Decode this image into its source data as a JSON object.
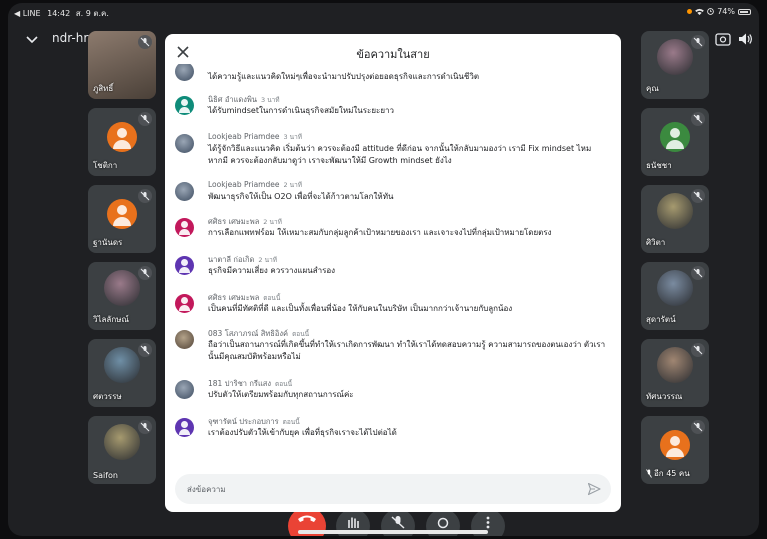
{
  "status_bar": {
    "back_app": "◀ LINE",
    "time": "14:42",
    "date": "ส. 9 ต.ค.",
    "battery": "74%"
  },
  "meeting": {
    "code": "ndr-hryf-rac",
    "code_arrow": "▸"
  },
  "participants_left": [
    {
      "name": "ภูสิทธิ์",
      "kind": "video"
    },
    {
      "name": "โชติกา",
      "kind": "initial",
      "color": "#e8711c"
    },
    {
      "name": "ฐานันดร",
      "kind": "initial",
      "color": "#e8711c"
    },
    {
      "name": "วิไลลักษณ์",
      "kind": "photo"
    },
    {
      "name": "ศตวรรษ",
      "kind": "photo"
    },
    {
      "name": "Saifon",
      "kind": "photo"
    }
  ],
  "participants_right": [
    {
      "name": "คุณ",
      "kind": "photo"
    },
    {
      "name": "ธนัชชา",
      "kind": "initial",
      "color": "#3b8a3f"
    },
    {
      "name": "ศิวิตา",
      "kind": "photo"
    },
    {
      "name": "สุดารัตน์",
      "kind": "photo"
    },
    {
      "name": "ทัศนวรรณ",
      "kind": "photo"
    },
    {
      "name": "อีก 45 คน",
      "kind": "initial",
      "color": "#e8711c"
    }
  ],
  "dialog": {
    "title": "ข้อความในสาย",
    "messages": [
      {
        "name": "",
        "time": "",
        "text": "ได้ความรู้และแนวคิดใหม่ๆเพื่อจะนำมาปรับปรุงต่อยอดธุรกิจและการดำเนินชีวิต",
        "avatar": "av-photo"
      },
      {
        "name": "นิธิศ อำแดงพิน",
        "time": "3 นาที",
        "text": "ได้รับmindsetในการดำเนินธุรกิจสมัยใหม่ในระยะยาว",
        "avatar": "av-teal"
      },
      {
        "name": "Lookjeab Priamdee",
        "time": "3 นาที",
        "text": "ได้รู้จักวิธีและแนวคิด เริ่มต้นว่า ควรจะต้องมี attitude ที่ดีก่อน จากนั้นให้กลับมามองว่า เรามี Fix mindset ไหม หากมี ควรจะต้องกลับมาดูว่า เราจะพัฒนาให้มี Growth mindset ยังไง",
        "avatar": "av-photo"
      },
      {
        "name": "Lookjeab Priamdee",
        "time": "2 นาที",
        "text": "พัฒนาธุรกิจให้เป็น O2O เพื่อที่จะได้ก้าวตามโลกให้ทัน",
        "avatar": "av-photo"
      },
      {
        "name": "ศศิธร เศษมะพล",
        "time": "2 นาที",
        "text": "การเลือกแพทฟร์อม ให้เหมาะสมกับกลุ่มลูกค้าเป้าหมายของเรา และเจาะจงไปที่กลุ่มเป้าหมายโดยตรง",
        "avatar": "av-pink"
      },
      {
        "name": "นาตาลี ก่อเกิด",
        "time": "2 นาที",
        "text": "ธุรกิจมีความเสี่ยง ควรวางแผนสำรอง",
        "avatar": "av-purple"
      },
      {
        "name": "ศศิธร เศษมะพล",
        "time": "ตอนนี้",
        "text": "เป็นคนที่มีทัศติที่ดี และเป็นทั้งเพื่อนพี่น้อง ให้กับคนในบริษัท เป็นมากกว่าเจ้านายกับลูกน้อง",
        "avatar": "av-pink"
      },
      {
        "name": "083 โสภาภรณ์ สิทธิอิงค์",
        "time": "ตอนนี้",
        "text": "ถือว่าเป็นสถานการณ์ที่เกิดขึ้นที่ทำให้เราเกิดการพัฒนา ทำให้เราได้ทดสอบความรู้ ความสามารถของตนเองว่า ตัวเรานั้นมีคุณสมบัติพร้อมหรือไม่",
        "avatar": "av-photo2"
      },
      {
        "name": "181 ปาริชา กรีแสง",
        "time": "ตอนนี้",
        "text": "ปรับตัวให้เตรียมพร้อมกับทุกสถานการณ์ค่ะ",
        "avatar": "av-photo"
      },
      {
        "name": "จุฑารัตน์ ประกอบการ",
        "time": "ตอนนี้",
        "text": "เราต้องปรับตัวให้เข้ากับยุค เพื่อที่ธุรกิจเราจะได้ไปต่อได้",
        "avatar": "av-purple"
      }
    ],
    "compose_placeholder": "ส่งข้อความ"
  },
  "colors": {
    "background": "#1f2023",
    "tile": "#3c4043",
    "end_call": "#ea4335",
    "dialog": "#ffffff"
  }
}
